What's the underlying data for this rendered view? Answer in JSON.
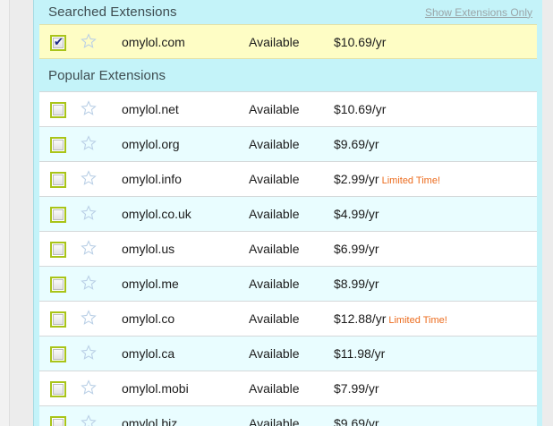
{
  "searched_section": {
    "title": "Searched Extensions",
    "show_link": "Show Extensions Only"
  },
  "searched_rows": [
    {
      "domain": "omylol.com",
      "status": "Available",
      "price": "$10.69/yr",
      "promo": "",
      "checked": true
    }
  ],
  "popular_section": {
    "title": "Popular Extensions"
  },
  "popular_rows": [
    {
      "domain": "omylol.net",
      "status": "Available",
      "price": "$10.69/yr",
      "promo": ""
    },
    {
      "domain": "omylol.org",
      "status": "Available",
      "price": "$9.69/yr",
      "promo": ""
    },
    {
      "domain": "omylol.info",
      "status": "Available",
      "price": "$2.99/yr",
      "promo": "Limited Time!"
    },
    {
      "domain": "omylol.co.uk",
      "status": "Available",
      "price": "$4.99/yr",
      "promo": ""
    },
    {
      "domain": "omylol.us",
      "status": "Available",
      "price": "$6.99/yr",
      "promo": ""
    },
    {
      "domain": "omylol.me",
      "status": "Available",
      "price": "$8.99/yr",
      "promo": ""
    },
    {
      "domain": "omylol.co",
      "status": "Available",
      "price": "$12.88/yr",
      "promo": "Limited Time!"
    },
    {
      "domain": "omylol.ca",
      "status": "Available",
      "price": "$11.98/yr",
      "promo": ""
    },
    {
      "domain": "omylol.mobi",
      "status": "Available",
      "price": "$7.99/yr",
      "promo": ""
    },
    {
      "domain": "omylol.biz",
      "status": "Available",
      "price": "$9.69/yr",
      "promo": ""
    }
  ],
  "colors": {
    "panel_bg": "#c4f3f9",
    "selected_row_bg": "#fefdc5",
    "checkbox_border": "#a9c419",
    "promo_text": "#ec6c1e"
  },
  "icons": {
    "favorite": "star-outline-icon",
    "check": "checkmark-icon"
  }
}
